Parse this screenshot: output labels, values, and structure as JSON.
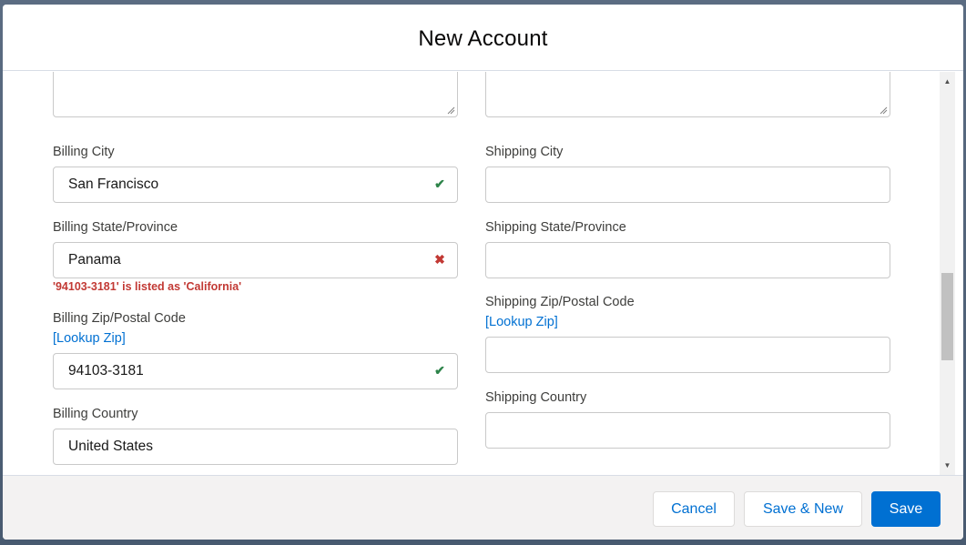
{
  "modal": {
    "title": "New Account"
  },
  "billing": {
    "city_label": "Billing City",
    "city_value": "San Francisco",
    "state_label": "Billing State/Province",
    "state_value": "Panama",
    "state_error": "'94103-3181' is listed as 'California'",
    "zip_label": "Billing Zip/Postal Code",
    "zip_lookup": "[Lookup Zip]",
    "zip_value": "94103-3181",
    "country_label": "Billing Country",
    "country_value": "United States"
  },
  "shipping": {
    "city_label": "Shipping City",
    "city_value": "",
    "state_label": "Shipping State/Province",
    "state_value": "",
    "zip_label": "Shipping Zip/Postal Code",
    "zip_lookup": "[Lookup Zip]",
    "zip_value": "",
    "country_label": "Shipping Country",
    "country_value": ""
  },
  "icons": {
    "valid": "check-icon",
    "invalid": "close-icon"
  },
  "colors": {
    "brand": "#0070d2",
    "error": "#c23934",
    "success": "#2e844a"
  },
  "footer": {
    "cancel_label": "Cancel",
    "save_new_label": "Save & New",
    "save_label": "Save"
  }
}
